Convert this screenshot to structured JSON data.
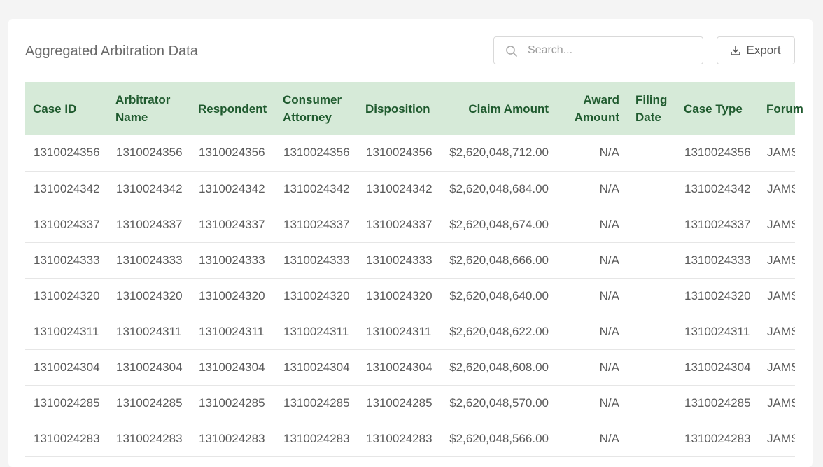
{
  "header": {
    "title": "Aggregated Arbitration Data",
    "search_placeholder": "Search...",
    "export_label": "Export"
  },
  "table": {
    "columns": [
      "Case ID",
      "Arbitrator Name",
      "Respondent",
      "Consumer Attorney",
      "Disposition",
      "Claim Amount",
      "Award Amount",
      "Filing Date",
      "Case Type",
      "Forum"
    ],
    "rows": [
      [
        "1310024356",
        "1310024356",
        "1310024356",
        "1310024356",
        "1310024356",
        "$2,620,048,712.00",
        "N/A",
        "",
        "1310024356",
        "JAMS"
      ],
      [
        "1310024342",
        "1310024342",
        "1310024342",
        "1310024342",
        "1310024342",
        "$2,620,048,684.00",
        "N/A",
        "",
        "1310024342",
        "JAMS"
      ],
      [
        "1310024337",
        "1310024337",
        "1310024337",
        "1310024337",
        "1310024337",
        "$2,620,048,674.00",
        "N/A",
        "",
        "1310024337",
        "JAMS"
      ],
      [
        "1310024333",
        "1310024333",
        "1310024333",
        "1310024333",
        "1310024333",
        "$2,620,048,666.00",
        "N/A",
        "",
        "1310024333",
        "JAMS"
      ],
      [
        "1310024320",
        "1310024320",
        "1310024320",
        "1310024320",
        "1310024320",
        "$2,620,048,640.00",
        "N/A",
        "",
        "1310024320",
        "JAMS"
      ],
      [
        "1310024311",
        "1310024311",
        "1310024311",
        "1310024311",
        "1310024311",
        "$2,620,048,622.00",
        "N/A",
        "",
        "1310024311",
        "JAMS"
      ],
      [
        "1310024304",
        "1310024304",
        "1310024304",
        "1310024304",
        "1310024304",
        "$2,620,048,608.00",
        "N/A",
        "",
        "1310024304",
        "JAMS"
      ],
      [
        "1310024285",
        "1310024285",
        "1310024285",
        "1310024285",
        "1310024285",
        "$2,620,048,570.00",
        "N/A",
        "",
        "1310024285",
        "JAMS"
      ],
      [
        "1310024283",
        "1310024283",
        "1310024283",
        "1310024283",
        "1310024283",
        "$2,620,048,566.00",
        "N/A",
        "",
        "1310024283",
        "JAMS"
      ]
    ]
  },
  "colors": {
    "header_bg": "#d6ead8",
    "header_text": "#1f5a2e",
    "page_bg": "#f4f4f4"
  }
}
